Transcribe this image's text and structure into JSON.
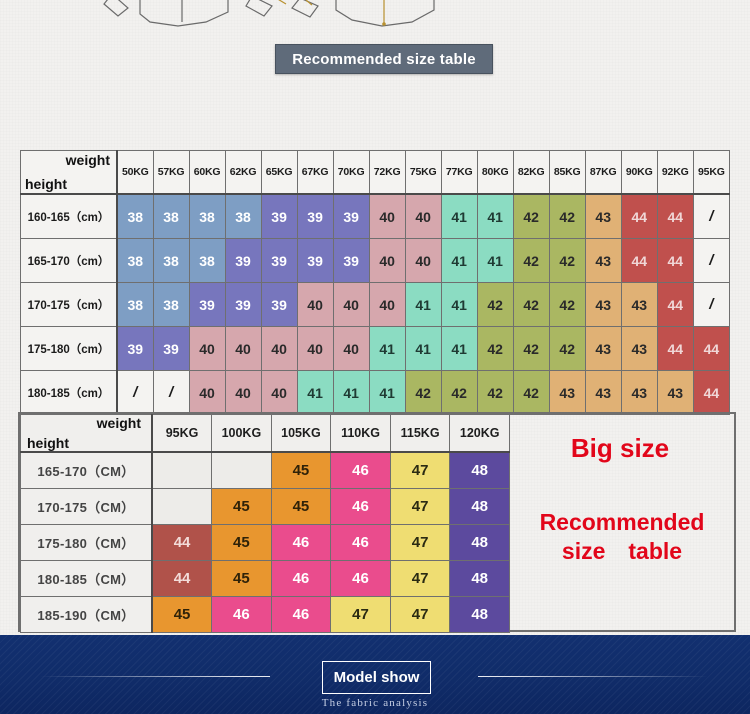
{
  "banner": {
    "label": "Recommended size table"
  },
  "table1": {
    "corner": {
      "weight_label": "weight",
      "height_label": "height"
    },
    "weight_headers": [
      "50KG",
      "57KG",
      "60KG",
      "62KG",
      "65KG",
      "67KG",
      "70KG",
      "72KG",
      "75KG",
      "77KG",
      "80KG",
      "82KG",
      "85KG",
      "87KG",
      "90KG",
      "92KG",
      "95KG"
    ],
    "rows": [
      {
        "height": "160-165（cm）",
        "values": [
          "38",
          "38",
          "38",
          "38",
          "39",
          "39",
          "39",
          "40",
          "40",
          "41",
          "41",
          "42",
          "42",
          "43",
          "44",
          "44",
          "/"
        ]
      },
      {
        "height": "165-170（cm）",
        "values": [
          "38",
          "38",
          "38",
          "39",
          "39",
          "39",
          "39",
          "40",
          "40",
          "41",
          "41",
          "42",
          "42",
          "43",
          "44",
          "44",
          "/"
        ]
      },
      {
        "height": "170-175（cm）",
        "values": [
          "38",
          "38",
          "39",
          "39",
          "39",
          "40",
          "40",
          "40",
          "41",
          "41",
          "42",
          "42",
          "42",
          "43",
          "43",
          "44",
          "/"
        ]
      },
      {
        "height": "175-180（cm）",
        "values": [
          "39",
          "39",
          "40",
          "40",
          "40",
          "40",
          "40",
          "41",
          "41",
          "41",
          "42",
          "42",
          "42",
          "43",
          "43",
          "44",
          "44"
        ]
      },
      {
        "height": "180-185（cm）",
        "values": [
          "/",
          "/",
          "40",
          "40",
          "40",
          "41",
          "41",
          "41",
          "42",
          "42",
          "42",
          "42",
          "43",
          "43",
          "43",
          "43",
          "44"
        ]
      }
    ],
    "colors": {
      "38": "#7e9ec4",
      "39": "#7776bd",
      "40": "#d6a7ad",
      "41": "#8bdcc2",
      "42": "#aab762",
      "43": "#e0b175",
      "44": "#c0504d",
      "slash": "#f4f3f1"
    },
    "text_colors": {
      "38": "#ffffff",
      "39": "#ffffff",
      "40": "#2a2a2a",
      "41": "#1f3a33",
      "42": "#2a2a2a",
      "43": "#2a2a2a",
      "44": "#f0d7d7",
      "slash": "#1b1b1b"
    }
  },
  "table2": {
    "corner": {
      "weight_label": "weight",
      "height_label": "height"
    },
    "weight_headers": [
      "95KG",
      "100KG",
      "105KG",
      "110KG",
      "115KG",
      "120KG"
    ],
    "rows": [
      {
        "height": "165-170（CM）",
        "values": [
          "",
          "",
          "45",
          "46",
          "47",
          "48"
        ]
      },
      {
        "height": "170-175（CM）",
        "values": [
          "",
          "45",
          "45",
          "46",
          "47",
          "48"
        ]
      },
      {
        "height": "175-180（CM）",
        "values": [
          "44",
          "45",
          "46",
          "46",
          "47",
          "48"
        ]
      },
      {
        "height": "180-185（CM）",
        "values": [
          "44",
          "45",
          "46",
          "46",
          "47",
          "48"
        ]
      },
      {
        "height": "185-190（CM）",
        "values": [
          "45",
          "46",
          "46",
          "47",
          "47",
          "48"
        ]
      }
    ],
    "colors": {
      "44": "#b0524a",
      "45": "#e8962f",
      "46": "#ea4c8d",
      "47": "#efdd72",
      "48": "#5c4a9e",
      "empty": "#edece9"
    },
    "text_colors": {
      "44": "#f3dcd9",
      "45": "#2f2208",
      "46": "#ffffff",
      "47": "#2a2a12",
      "48": "#ffffff",
      "empty": "#edece9"
    }
  },
  "captions": {
    "big_size": "Big size",
    "recommended_line1": "Recommended",
    "recommended_line2": "size　table"
  },
  "footer": {
    "model_show": "Model show",
    "fabric_analysis": "The fabric analysis"
  },
  "theme": {
    "banner_bg": "#5f6b7a",
    "red_accent": "#e2061a",
    "blue_band": "#102c69",
    "page_bg": "#f2f1ef"
  }
}
